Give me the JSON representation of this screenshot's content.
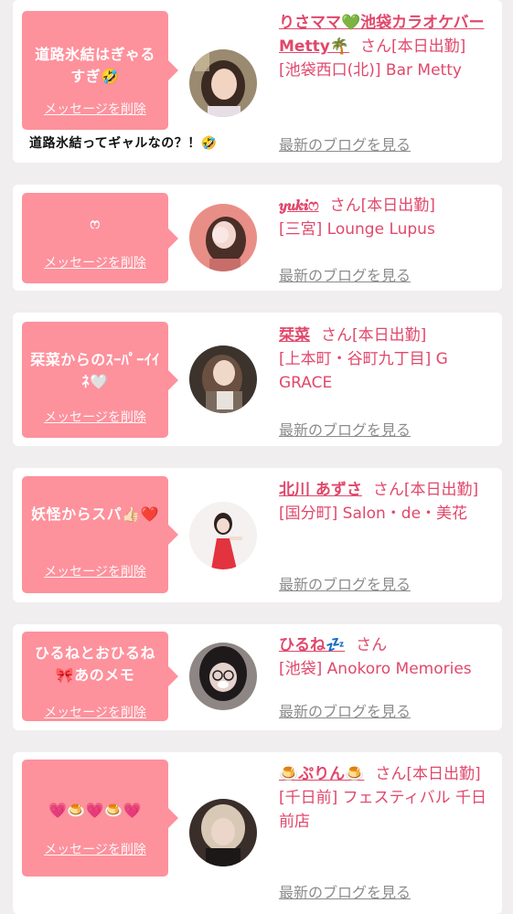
{
  "colors": {
    "background": "#f1eeef",
    "card": "#ffffff",
    "bubble": "#fd919c",
    "name": "#e0486b",
    "blog_link": "#8c8c8c"
  },
  "common": {
    "delete_label": "メッセージを削除",
    "blog_label": "最新のブログを見る",
    "san_suffix": "さん"
  },
  "annotation": "道路氷結ってギャルなの？！🤣",
  "cards": [
    {
      "message": "道路氷結はぎゃるすぎ🤣",
      "name": "りさママ💚池袋カラオケバーMetty🌴",
      "status": "[本日出勤]",
      "shop": "[池袋西口(北)] Bar Metty",
      "avatar_icon": "woman-portrait-icon"
    },
    {
      "message": "ෆ",
      "name": "𝒚𝒖𝒌𝒊ෆ",
      "status": "[本日出勤]",
      "shop": "[三宮] Lounge Lupus",
      "avatar_icon": "woman-portrait-icon"
    },
    {
      "message": "栞菜からのｽｰﾊﾟｰｲｲﾈ🤍",
      "name": "栞菜",
      "status": "[本日出勤]",
      "shop": "[上本町・谷町九丁目] G GRACE",
      "avatar_icon": "woman-portrait-icon"
    },
    {
      "message": "妖怪からスパ👍🏻❤️",
      "name": "北川 あずさ",
      "status": "[本日出勤]",
      "shop": "[国分町] Salon・de・美花",
      "avatar_icon": "woman-portrait-icon"
    },
    {
      "message": "ひるねとおひるね🎀あのメモ",
      "name": "ひるね💤",
      "status": "",
      "shop": "[池袋] Anokoro Memories",
      "avatar_icon": "woman-portrait-icon"
    },
    {
      "message": "💗🍮💗🍮💗",
      "name": "🍮ぷりん🍮",
      "status": "[本日出勤]",
      "shop": "[千日前] フェスティバル 千日前店",
      "avatar_icon": "woman-portrait-icon"
    }
  ]
}
